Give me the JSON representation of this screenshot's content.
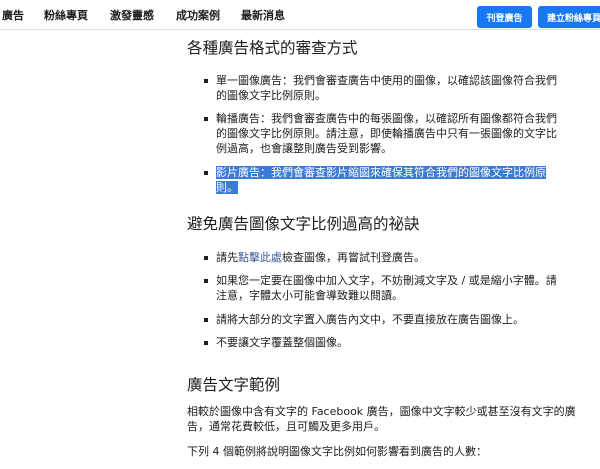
{
  "header": {
    "nav": [
      "廣告",
      "粉絲專頁",
      "激發靈感",
      "成功案例",
      "最新消息"
    ],
    "advertise_button": "刊登廣告",
    "create_page_button": "建立粉絲專頁"
  },
  "main": {
    "section_formats": {
      "title": "各種廣告格式的審查方式",
      "items": [
        "單一圖像廣告：我們會審查廣告中使用的圖像，以確認該圖像符合我們的圖像文字比例原則。",
        "輪播廣告：我們會審查廣告中的每張圖像，以確認所有圖像都符合我們的圖像文字比例原則。請注意，即使輪播廣告中只有一張圖像的文字比例過高，也會讓整則廣告受到影響。",
        "影片廣告：我們會審查影片縮圖來確保其符合我們的圖像文字比例原則。"
      ]
    },
    "section_avoid": {
      "title": "避免廣告圖像文字比例過高的祕訣",
      "item1_prefix": "請先",
      "item1_link": "點擊此處",
      "item1_suffix": "檢查圖像，再嘗試刊登廣告。",
      "items": [
        "如果您一定要在圖像中加入文字，不妨刪減文字及 / 或是縮小字體。請注意，字體太小可能會導致難以閱讀。",
        "請將大部分的文字置入廣告內文中，不要直接放在廣告圖像上。",
        "不要讓文字覆蓋整個圖像。"
      ]
    },
    "section_samples": {
      "title": "廣告文字範例",
      "paragraph1": "相較於圖像中含有文字的 Facebook 廣告，圖像中文字較少或甚至沒有文字的廣告，通常花費較低，且可觸及更多用戶。",
      "paragraph2": "下列 4 個範例將說明圖像文字比例如何影響看到廣告的人數："
    }
  },
  "colors": {
    "accent": "#1877f2",
    "highlight": "#3a7bd5",
    "link": "#385898",
    "text": "#1c1e21"
  }
}
